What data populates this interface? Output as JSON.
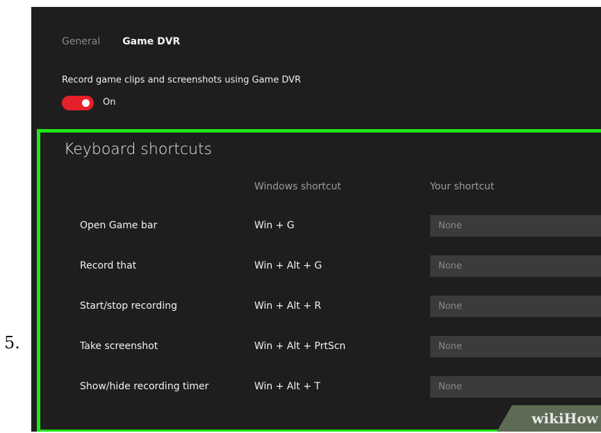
{
  "step_number": "5.",
  "tabs": [
    {
      "label": "General",
      "active": false
    },
    {
      "label": "Game DVR",
      "active": true
    }
  ],
  "record_setting": {
    "label": "Record game clips and screenshots using Game DVR",
    "toggle_state": "On",
    "toggle_color": "#e6202a"
  },
  "shortcuts": {
    "title": "Keyboard shortcuts",
    "col_windows": "Windows shortcut",
    "col_yours": "Your shortcut",
    "rows": [
      {
        "action": "Open Game bar",
        "windows": "Win + G",
        "yours": "None"
      },
      {
        "action": "Record that",
        "windows": "Win + Alt + G",
        "yours": "None"
      },
      {
        "action": "Start/stop recording",
        "windows": "Win + Alt + R",
        "yours": "None"
      },
      {
        "action": "Take screenshot",
        "windows": "Win + Alt + PrtScn",
        "yours": "None"
      },
      {
        "action": "Show/hide recording timer",
        "windows": "Win + Alt + T",
        "yours": "None"
      }
    ]
  },
  "highlight_color": "#1fe61a",
  "watermark": "wikiHow"
}
